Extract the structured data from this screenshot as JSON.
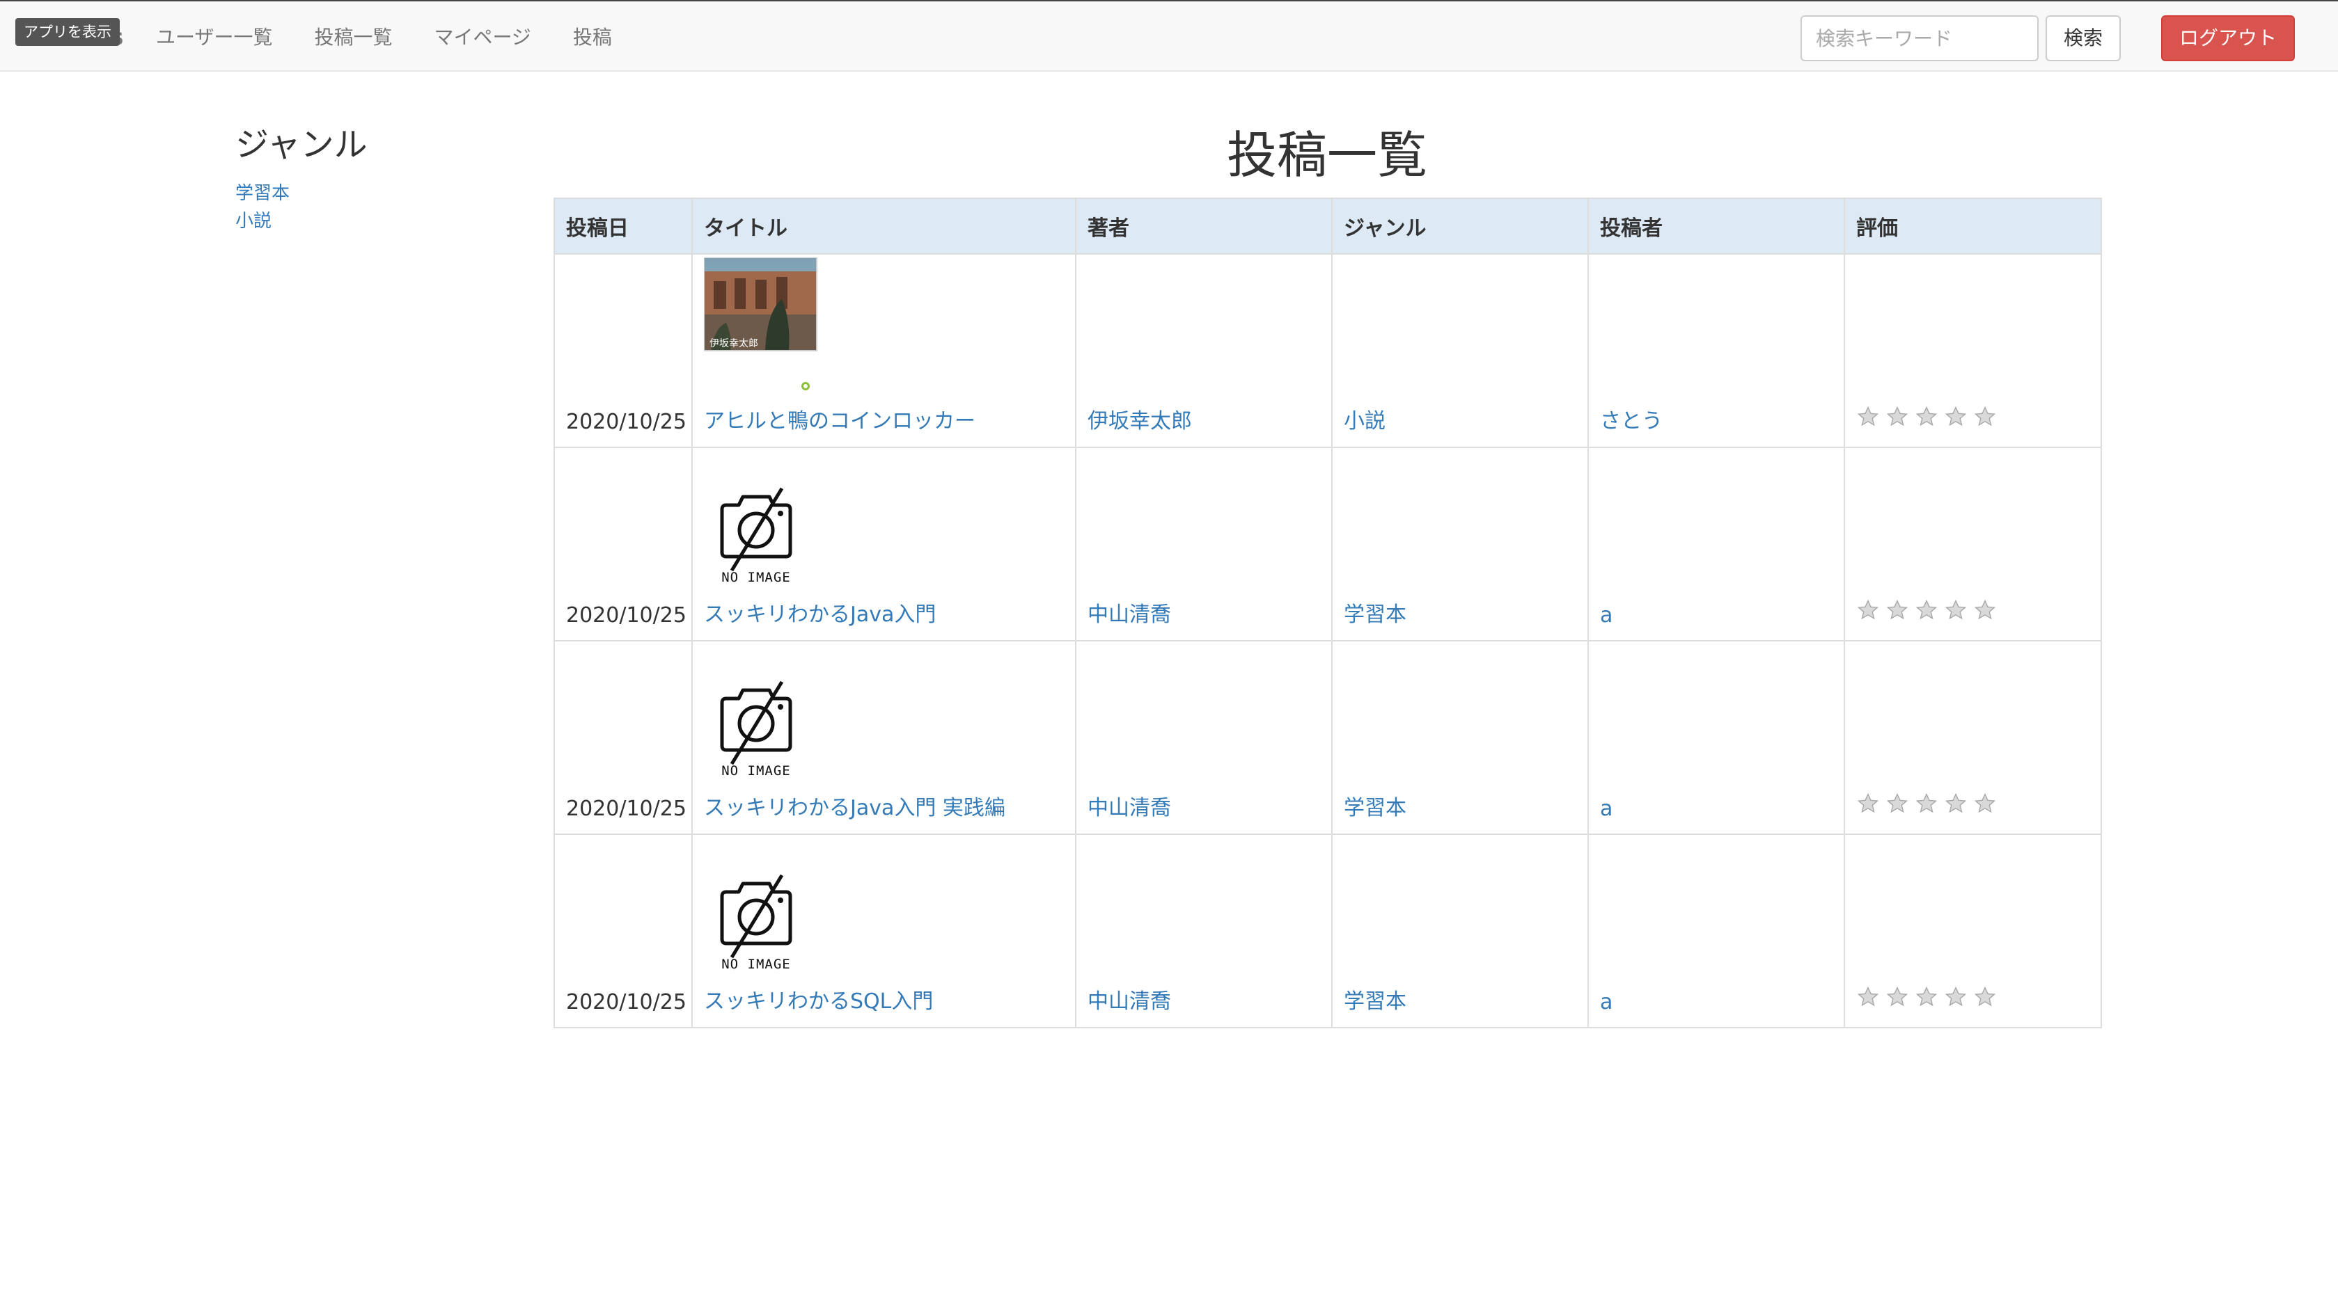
{
  "navbar": {
    "brand": "Bookers",
    "app_badge": "アプリを表示",
    "links": [
      "ユーザー一覧",
      "投稿一覧",
      "マイページ",
      "投稿"
    ],
    "search_placeholder": "検索キーワード",
    "search_button": "検索",
    "logout_button": "ログアウト",
    "logout_color": "#d9534f"
  },
  "sidebar": {
    "title": "ジャンル",
    "genres": [
      "学習本",
      "小説"
    ]
  },
  "main": {
    "title": "投稿一覧",
    "columns": [
      "投稿日",
      "タイトル",
      "著者",
      "ジャンル",
      "投稿者",
      "評価"
    ],
    "no_image_caption": "NO IMAGE",
    "rows": [
      {
        "date": "2020/10/25",
        "image": "book-cover-photo",
        "title": "アヒルと鴨のコインロッカー",
        "author": "伊坂幸太郎",
        "genre": "小説",
        "poster": "さとう",
        "rating": 0
      },
      {
        "date": "2020/10/25",
        "image": "no-image-icon",
        "title": "スッキリわかるJava入門",
        "author": "中山清喬",
        "genre": "学習本",
        "poster": "a",
        "rating": 0
      },
      {
        "date": "2020/10/25",
        "image": "no-image-icon",
        "title": "スッキリわかるJava入門 実践編",
        "author": "中山清喬",
        "genre": "学習本",
        "poster": "a",
        "rating": 0
      },
      {
        "date": "2020/10/25",
        "image": "no-image-icon",
        "title": "スッキリわかるSQL入門",
        "author": "中山清喬",
        "genre": "学習本",
        "poster": "a",
        "rating": 0
      }
    ]
  }
}
